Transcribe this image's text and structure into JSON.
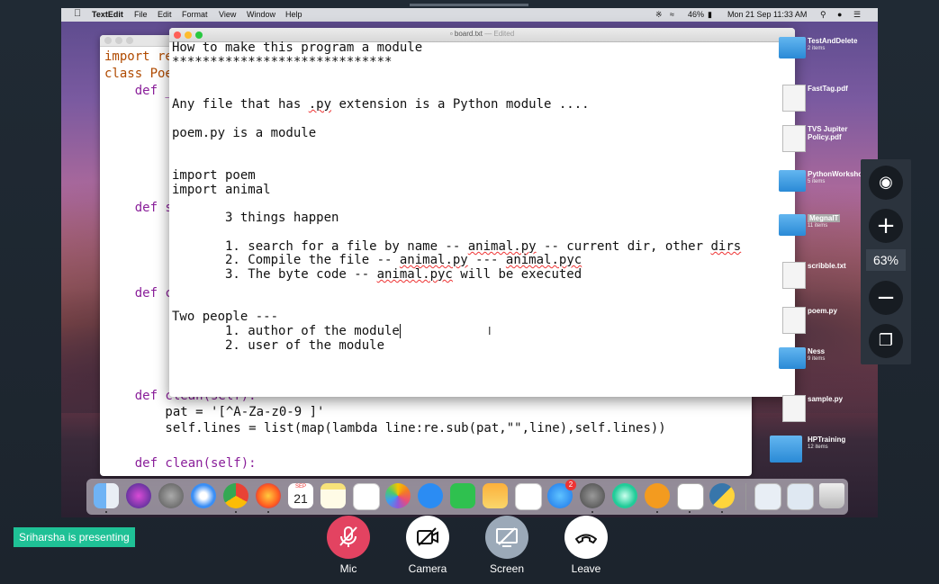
{
  "menubar": {
    "app": "TextEdit",
    "items": [
      "File",
      "Edit",
      "Format",
      "View",
      "Window",
      "Help"
    ],
    "battery": "46%",
    "datetime": "Mon 21 Sep  11:33 AM"
  },
  "code_editor": {
    "lines": [
      "import re",
      "class Poe",
      "    def _",
      "    def s",
      "    def c",
      "    def clean(self):",
      "        pat = '[^A-Za-z0-9 ]'",
      "        self.lines = list(map(lambda line:re.sub(pat,\"\",line),self.lines))",
      "    def clean(self):"
    ]
  },
  "textedit": {
    "title": "board.txt",
    "title_status": "— Edited",
    "line1": "How to make this program a module",
    "line2": "*****************************",
    "line3a": "Any file that has ",
    "line3b": ".py",
    "line3c": " extension is a Python module ....",
    "line4": "poem.py is a module",
    "line5": "import poem",
    "line6": "import animal",
    "line7": "       3 things happen",
    "line8a": "       1. search for a file by name -- ",
    "line8b": "animal.py",
    "line8c": " -- current dir, other ",
    "line8d": "dirs",
    "line9a": "       2. Compile the file -- ",
    "line9b": "animal.py",
    "line9c": " --- ",
    "line9d": "animal.pyc",
    "line10a": "       3. The byte code -- ",
    "line10b": "animal.pyc",
    "line10c": " will be executed",
    "line11": "Two people ---",
    "line12": "       1. author of the module",
    "line13": "       2. user of the module"
  },
  "desktop": [
    {
      "name": "TestAndDelete",
      "sub": "2 items",
      "kind": "folder"
    },
    {
      "name": "FastTag.pdf",
      "sub": "",
      "kind": "file"
    },
    {
      "name": "TVS Jupiter\nPolicy.pdf",
      "sub": "",
      "kind": "file"
    },
    {
      "name": "PythonWorkshop",
      "sub": "5 items",
      "kind": "folder"
    },
    {
      "name": "MegnaIT",
      "sub": "11 items",
      "kind": "folder"
    },
    {
      "name": "scribble.txt",
      "sub": "",
      "kind": "file"
    },
    {
      "name": "poem.py",
      "sub": "",
      "kind": "file"
    },
    {
      "name": "Ness",
      "sub": "9 items",
      "kind": "folder"
    },
    {
      "name": "sample.py",
      "sub": "",
      "kind": "file"
    },
    {
      "name": "HPTraining",
      "sub": "12 items",
      "kind": "folder"
    }
  ],
  "dock": {
    "calendar_month": "SEP",
    "calendar_day": "21",
    "appstore_badge": "2"
  },
  "zoom": {
    "level": "63%"
  },
  "meeting": {
    "presenter": "Sriharsha is presenting",
    "controls": [
      "Mic",
      "Camera",
      "Screen",
      "Leave"
    ]
  },
  "colors": {
    "mic": "#e34361",
    "camera": "#ffffff",
    "screen": "#9ba9b8",
    "leave": "#ffffff",
    "presenter_bg": "#1fc196"
  }
}
